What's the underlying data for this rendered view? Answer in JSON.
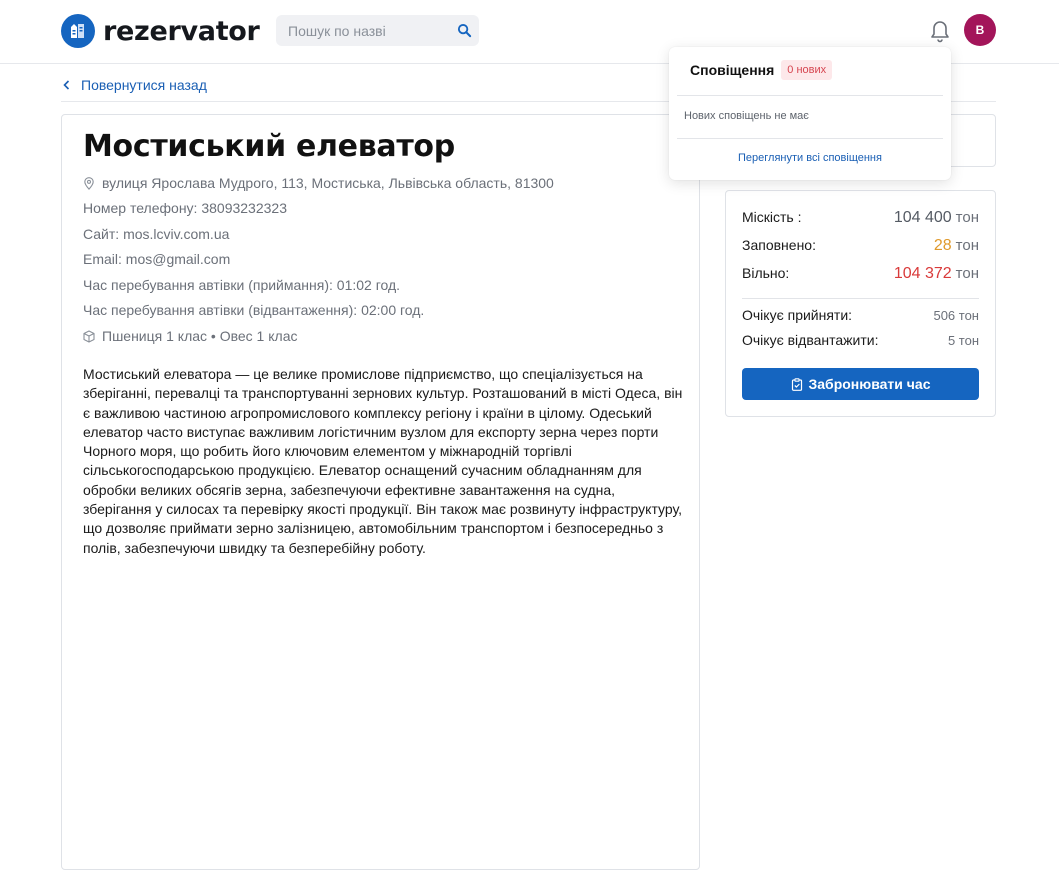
{
  "header": {
    "logo_text": "rezervator",
    "search_placeholder": "Пошук по назві",
    "avatar_initial": "В"
  },
  "nav": {
    "back_label": "Повернутися назад"
  },
  "elevator": {
    "name": "Мостиський елеватор",
    "address": "вулиця Ярослава Мудрого, 113, Мостиська, Львівська область, 81300",
    "phone": "Номер телефону: 38093232323",
    "site": "Сайт: mos.lcviv.com.ua",
    "email": "Email: mos@gmail.com",
    "receive_time": "Час перебування автівки (приймання): 01:02 год.",
    "ship_time": "Час перебування автівки (відвантаження): 02:00 год.",
    "crops": "Пшениця 1 клас • Овес 1 клас",
    "description": "Мостиський елеватора — це велике промислове підприємство, що спеціалізується на зберіганні, перевалці та транспортуванні зернових культур. Розташований в місті Одеса, він є важливою частиною агропромислового комплексу регіону і країни в цілому. Одеський елеватор часто виступає важливим логістичним вузлом для експорту зерна через порти Чорного моря, що робить його ключовим елементом у міжнародній торгівлі сільськогосподарською продукцією. Елеватор оснащений сучасним обладнанням для обробки великих обсягів зерна, забезпечуючи ефективне завантаження на судна, зберігання у силосах та перевірку якості продукції. Він також має розвинуту інфраструктуру, що дозволяє приймати зерно залізницею, автомобільним транспортом і безпосередньо з полів, забезпечуючи швидку та безперебійну роботу."
  },
  "capacity": {
    "capacity_label": "Міскість :",
    "capacity_value": "104 400",
    "filled_label": "Заповнено:",
    "filled_value": "28",
    "free_label": "Вільно:",
    "free_value": "104 372",
    "unit": "тон",
    "expect_receive_label": "Очікує прийняти:",
    "expect_receive_value": "506 тон",
    "expect_ship_label": "Очікує відвантажити:",
    "expect_ship_value": "5 тон",
    "book_label": "Забронювати час",
    "colors": {
      "capacity": "#555b64",
      "filled": "#e09a2c",
      "free": "#d93a3a"
    }
  },
  "notifications": {
    "title": "Сповіщення",
    "badge": "0 нових",
    "empty_text": "Нових сповіщень не має",
    "view_all": "Переглянути всі сповіщення"
  },
  "icons": {
    "logo": "elevator-logo-icon",
    "search": "search-icon",
    "bell": "bell-icon",
    "back": "chevron-left-icon",
    "location": "map-pin-icon",
    "crops": "box-icon",
    "book": "clipboard-icon"
  },
  "theme": {
    "primary": "#1565c0",
    "avatar_bg": "#a3155a"
  }
}
